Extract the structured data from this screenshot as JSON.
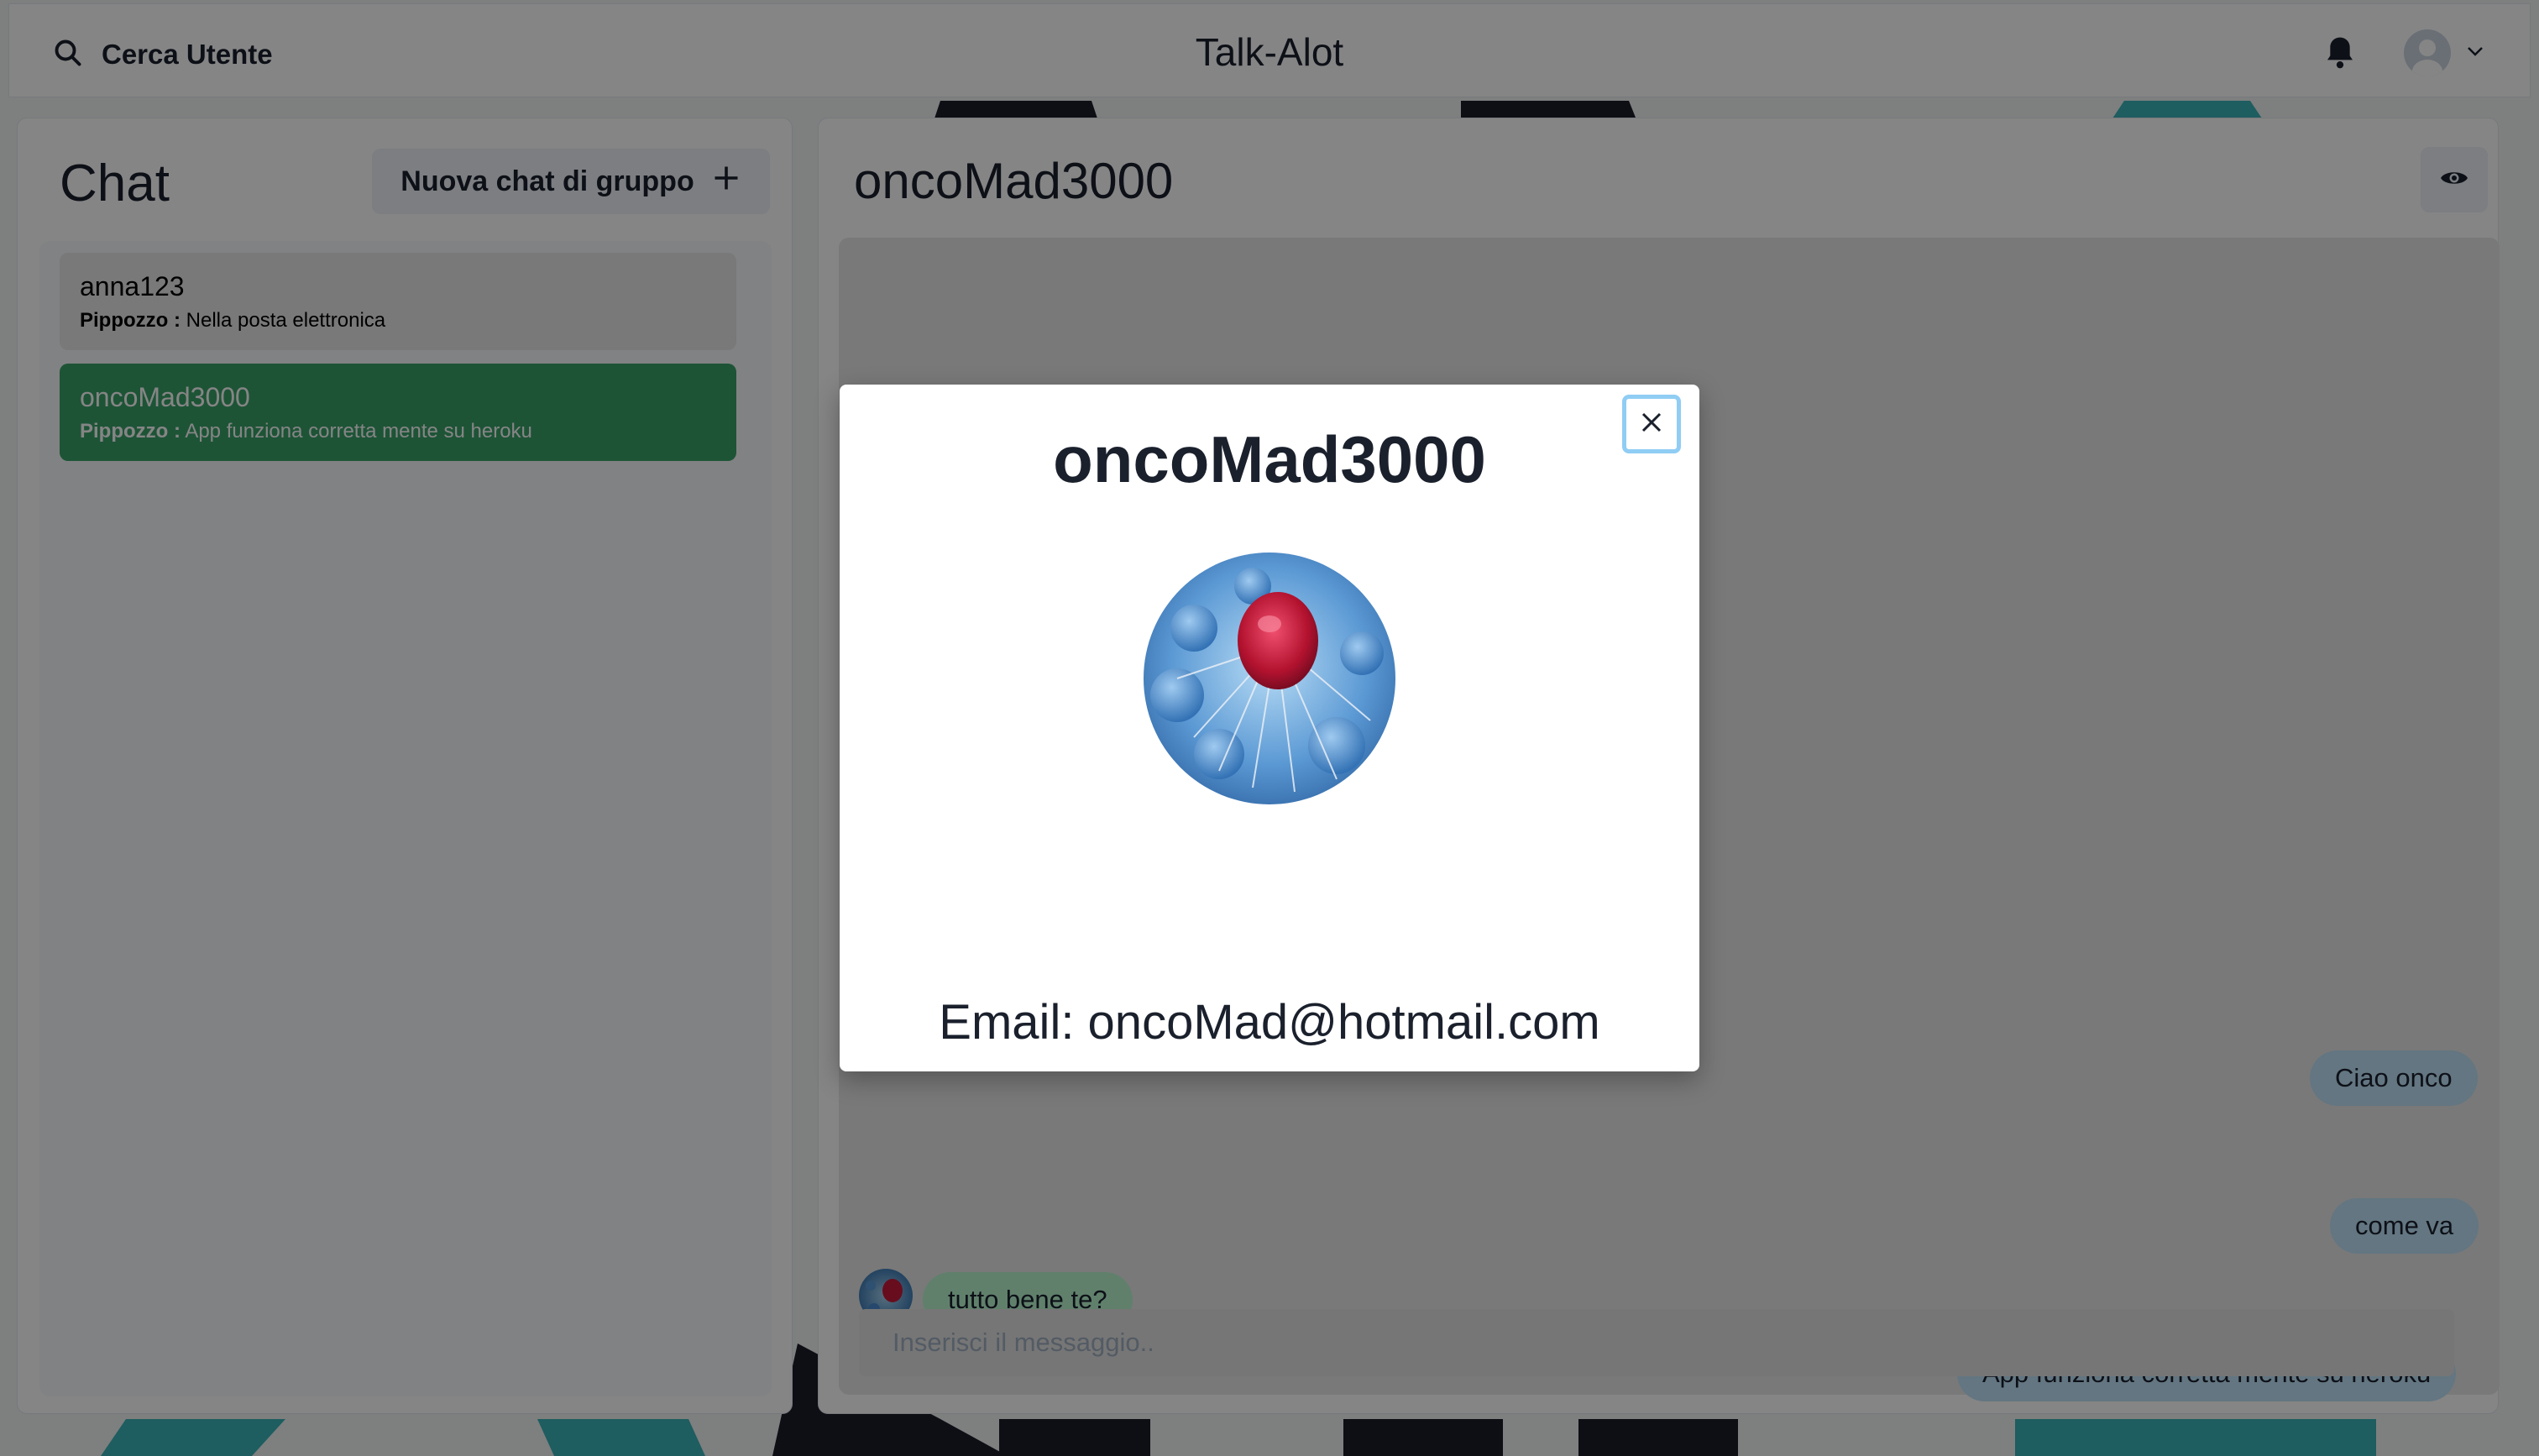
{
  "header": {
    "search_label": "Cerca Utente",
    "app_title": "Talk-Alot"
  },
  "sidebar": {
    "title": "Chat",
    "new_group_label": "Nuova chat di gruppo",
    "chats": [
      {
        "name": "anna123",
        "sender": "Pippozzo :",
        "last_message": "Nella posta elettronica"
      },
      {
        "name": "oncoMad3000",
        "sender": "Pippozzo :",
        "last_message": "App funziona corretta mente su heroku"
      }
    ]
  },
  "conversation": {
    "title": "oncoMad3000",
    "messages": [
      {
        "text": "Ciao onco",
        "from": "me"
      },
      {
        "text": "come va",
        "from": "me"
      },
      {
        "text": "tutto bene te?",
        "from": "them"
      },
      {
        "text": "App funziona corretta mente su heroku",
        "from": "me"
      }
    ],
    "input_placeholder": "Inserisci il messaggio.."
  },
  "modal": {
    "title": "oncoMad3000",
    "email": "Email: oncoMad@hotmail.com"
  },
  "colors": {
    "selected_chat": "#38a169",
    "my_bubble": "#bee3f8",
    "their_bubble": "#b9f5d0"
  }
}
